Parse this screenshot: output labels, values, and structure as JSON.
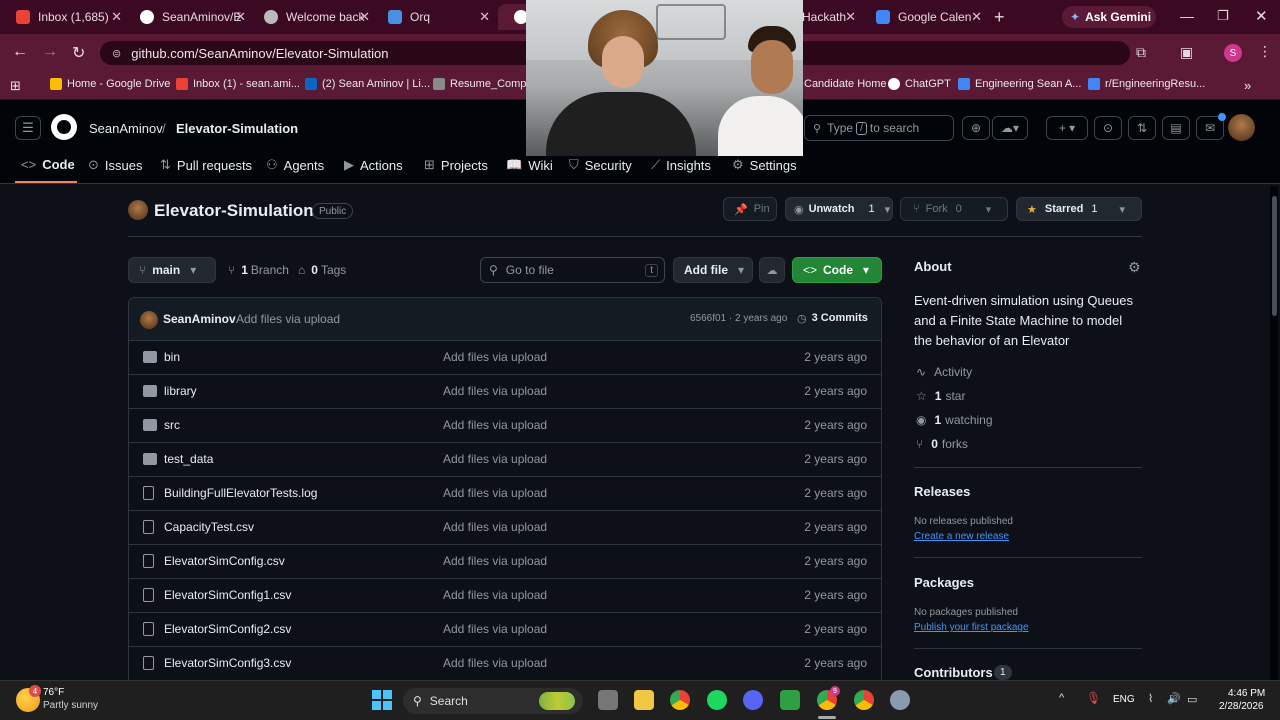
{
  "browser": {
    "tabs": [
      {
        "title": "Inbox (1,685)",
        "icon": "gmail-icon",
        "color": "#ea4335"
      },
      {
        "title": "SeanAminov/E",
        "icon": "github-icon",
        "color": "#ffffff"
      },
      {
        "title": "Welcome back",
        "icon": "globe-icon",
        "color": "#bbbbbb"
      },
      {
        "title": "Orq",
        "icon": "orq-icon",
        "color": "#4a90e2"
      },
      {
        "title": "Hackath",
        "icon": "tab-icon",
        "color": "#e8d9e0"
      },
      {
        "title": "Google Calen",
        "icon": "calendar-icon",
        "color": "#4285f4"
      }
    ],
    "new_tab_label": "+",
    "gemini_label": "Ask Gemini",
    "url": "github.com/SeanAminov/Elevator-Simulation",
    "profile_initial": "S",
    "bookmarks": [
      {
        "label": "Home - Google Drive",
        "color": "#fbbc04"
      },
      {
        "label": "Inbox (1) - sean.ami...",
        "color": "#ea4335"
      },
      {
        "label": "(2) Sean Aminov | Li...",
        "color": "#0a66c2"
      },
      {
        "label": "Resume_CompSc",
        "color": "#8a8a8a"
      },
      {
        "label": "Candidate Home",
        "color": "#f4b400"
      },
      {
        "label": "ChatGPT",
        "color": "#ffffff"
      },
      {
        "label": "Engineering Sean A...",
        "color": "#4285f4"
      },
      {
        "label": "r/EngineeringResu...",
        "color": "#4285f4"
      }
    ]
  },
  "github": {
    "owner": "SeanAminov",
    "separator": "/",
    "repo": "Elevator-Simulation",
    "search_placeholder_pre": "Type",
    "search_key": "/",
    "search_placeholder_post": "to search",
    "nav": [
      {
        "label": "Code",
        "icon": "code-icon"
      },
      {
        "label": "Issues",
        "icon": "issue-icon"
      },
      {
        "label": "Pull requests",
        "icon": "pull-request-icon"
      },
      {
        "label": "Agents",
        "icon": "agents-icon"
      },
      {
        "label": "Actions",
        "icon": "actions-icon"
      },
      {
        "label": "Projects",
        "icon": "projects-icon"
      },
      {
        "label": "Wiki",
        "icon": "wiki-icon"
      },
      {
        "label": "Security",
        "icon": "shield-icon"
      },
      {
        "label": "Insights",
        "icon": "graph-icon"
      },
      {
        "label": "Settings",
        "icon": "gear-icon"
      }
    ],
    "repo_title": "Elevator-Simulation",
    "visibility": "Public",
    "pin_label": "Pin",
    "unwatch_label": "Unwatch",
    "watch_count": "1",
    "fork_label": "Fork",
    "fork_count": "0",
    "starred_label": "Starred",
    "star_count": "1",
    "branch_name": "main",
    "branch_count": "1",
    "branch_label": "Branch",
    "tag_count": "0",
    "tag_label": "Tags",
    "go_to_file_placeholder": "Go to file",
    "go_to_file_key": "t",
    "add_file_label": "Add file",
    "code_button_label": "Code",
    "commit": {
      "author": "SeanAminov",
      "message": "Add files via upload",
      "hash_age": "6566f01 · 2 years ago",
      "count_label": "3 Commits"
    },
    "files": [
      {
        "name": "bin",
        "type": "folder",
        "message": "Add files via upload",
        "age": "2 years ago"
      },
      {
        "name": "library",
        "type": "folder",
        "message": "Add files via upload",
        "age": "2 years ago"
      },
      {
        "name": "src",
        "type": "folder",
        "message": "Add files via upload",
        "age": "2 years ago"
      },
      {
        "name": "test_data",
        "type": "folder",
        "message": "Add files via upload",
        "age": "2 years ago"
      },
      {
        "name": "BuildingFullElevatorTests.log",
        "type": "file",
        "message": "Add files via upload",
        "age": "2 years ago"
      },
      {
        "name": "CapacityTest.csv",
        "type": "file",
        "message": "Add files via upload",
        "age": "2 years ago"
      },
      {
        "name": "ElevatorSimConfig.csv",
        "type": "file",
        "message": "Add files via upload",
        "age": "2 years ago"
      },
      {
        "name": "ElevatorSimConfig1.csv",
        "type": "file",
        "message": "Add files via upload",
        "age": "2 years ago"
      },
      {
        "name": "ElevatorSimConfig2.csv",
        "type": "file",
        "message": "Add files via upload",
        "age": "2 years ago"
      },
      {
        "name": "ElevatorSimConfig3.csv",
        "type": "file",
        "message": "Add files via upload",
        "age": "2 years ago"
      }
    ],
    "about": {
      "heading": "About",
      "description": "Event-driven simulation using Queues and a Finite State Machine to model the behavior of an Elevator",
      "activity_label": "Activity",
      "stars_count": "1",
      "stars_label": "star",
      "watching_count": "1",
      "watching_label": "watching",
      "forks_count": "0",
      "forks_label": "forks"
    },
    "releases": {
      "heading": "Releases",
      "empty": "No releases published",
      "link": "Create a new release"
    },
    "packages": {
      "heading": "Packages",
      "empty": "No packages published",
      "link": "Publish your first package"
    },
    "contributors": {
      "heading": "Contributors",
      "count": "1"
    }
  },
  "taskbar": {
    "weather_badge": "4",
    "temperature": "76°F",
    "condition": "Partly sunny",
    "search_label": "Search",
    "language": "ENG",
    "time": "4:46 PM",
    "date": "2/28/2026",
    "chrome_badge": "9"
  },
  "colors": {
    "accent_green": "#238636",
    "link_blue": "#4493f8",
    "nav_underline": "#f78166",
    "browser_frame": "#5a1a36"
  }
}
